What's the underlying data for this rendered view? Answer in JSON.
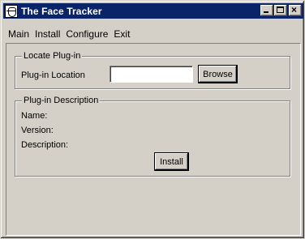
{
  "window": {
    "title": "The Face Tracker",
    "icon": "face-tracker-app-icon",
    "controls": {
      "minimize": "minimize-icon",
      "maximize": "maximize-icon",
      "close_glyph": "×"
    }
  },
  "menu": {
    "items": [
      {
        "label": "Main"
      },
      {
        "label": "Install"
      },
      {
        "label": "Configure"
      },
      {
        "label": "Exit"
      }
    ]
  },
  "locate_group": {
    "title": "Locate Plug-in",
    "location_label": "Plug-in Location",
    "location_value": "",
    "browse_label": "Browse"
  },
  "description_group": {
    "title": "Plug-in Description",
    "name_label": "Name:",
    "version_label": "Version:",
    "description_label": "Description:",
    "install_label": "Install"
  },
  "colors": {
    "titlebar": "#0a246a",
    "window_bg": "#d4d0c8"
  }
}
